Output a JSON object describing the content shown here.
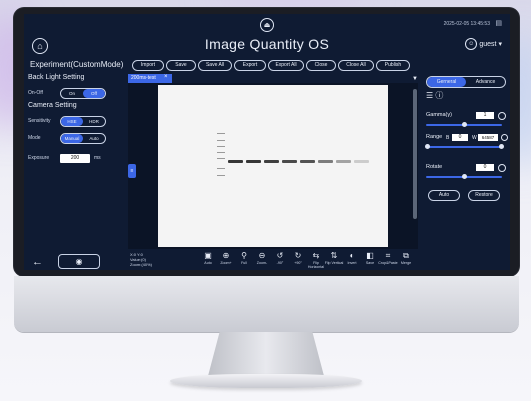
{
  "header": {
    "title": "Image Quantity OS",
    "clock": "2025-02-05 13:45:53",
    "user": "guest"
  },
  "toolbar": {
    "experiment_title": "Experiment(CustomMode)",
    "buttons": [
      "Import",
      "Save",
      "Save All",
      "Export",
      "Export All",
      "Close",
      "Close All",
      "Publish"
    ]
  },
  "left_panel": {
    "backlight_heading": "Back Light Setting",
    "onoff_label": "On-Off",
    "onoff_options": [
      "On",
      "Off"
    ],
    "camera_heading": "Camera Setting",
    "sensitivity_label": "Sensitivity",
    "sensitivity_options": [
      "HSE",
      "HDR"
    ],
    "mode_label": "Mode",
    "mode_options": [
      "Manual",
      "Auto"
    ],
    "exposure_label": "Exposure",
    "exposure_value": "200",
    "exposure_unit": "ms"
  },
  "image_tab": {
    "name": "200ms-test"
  },
  "status": {
    "line1": "X:0 Y:0",
    "line2": "Value:(0)",
    "line3": "Zoom:(40%)"
  },
  "bottom_tools": [
    "Auto",
    "Zoom+",
    "Full",
    "Zoom-",
    "-90°",
    "+90°",
    "Flip Horizontal",
    "Flip Vertical",
    "Invert",
    "Save",
    "Crop&Paste",
    "Merge"
  ],
  "right_panel": {
    "tabs": [
      "Gerneral",
      "Advance"
    ],
    "gamma_label": "Gamma(γ)",
    "gamma_value": "1",
    "range_label": "Range",
    "range_low_label": "B",
    "range_low": "0",
    "range_high_label": "W",
    "range_high": "64587",
    "rotate_label": "Rotate",
    "rotate_value": "0",
    "auto_button": "Auto",
    "restore_button": "Restore"
  },
  "colors": {
    "screen_bg": "#0f1b33",
    "accent": "#3c67e6"
  }
}
